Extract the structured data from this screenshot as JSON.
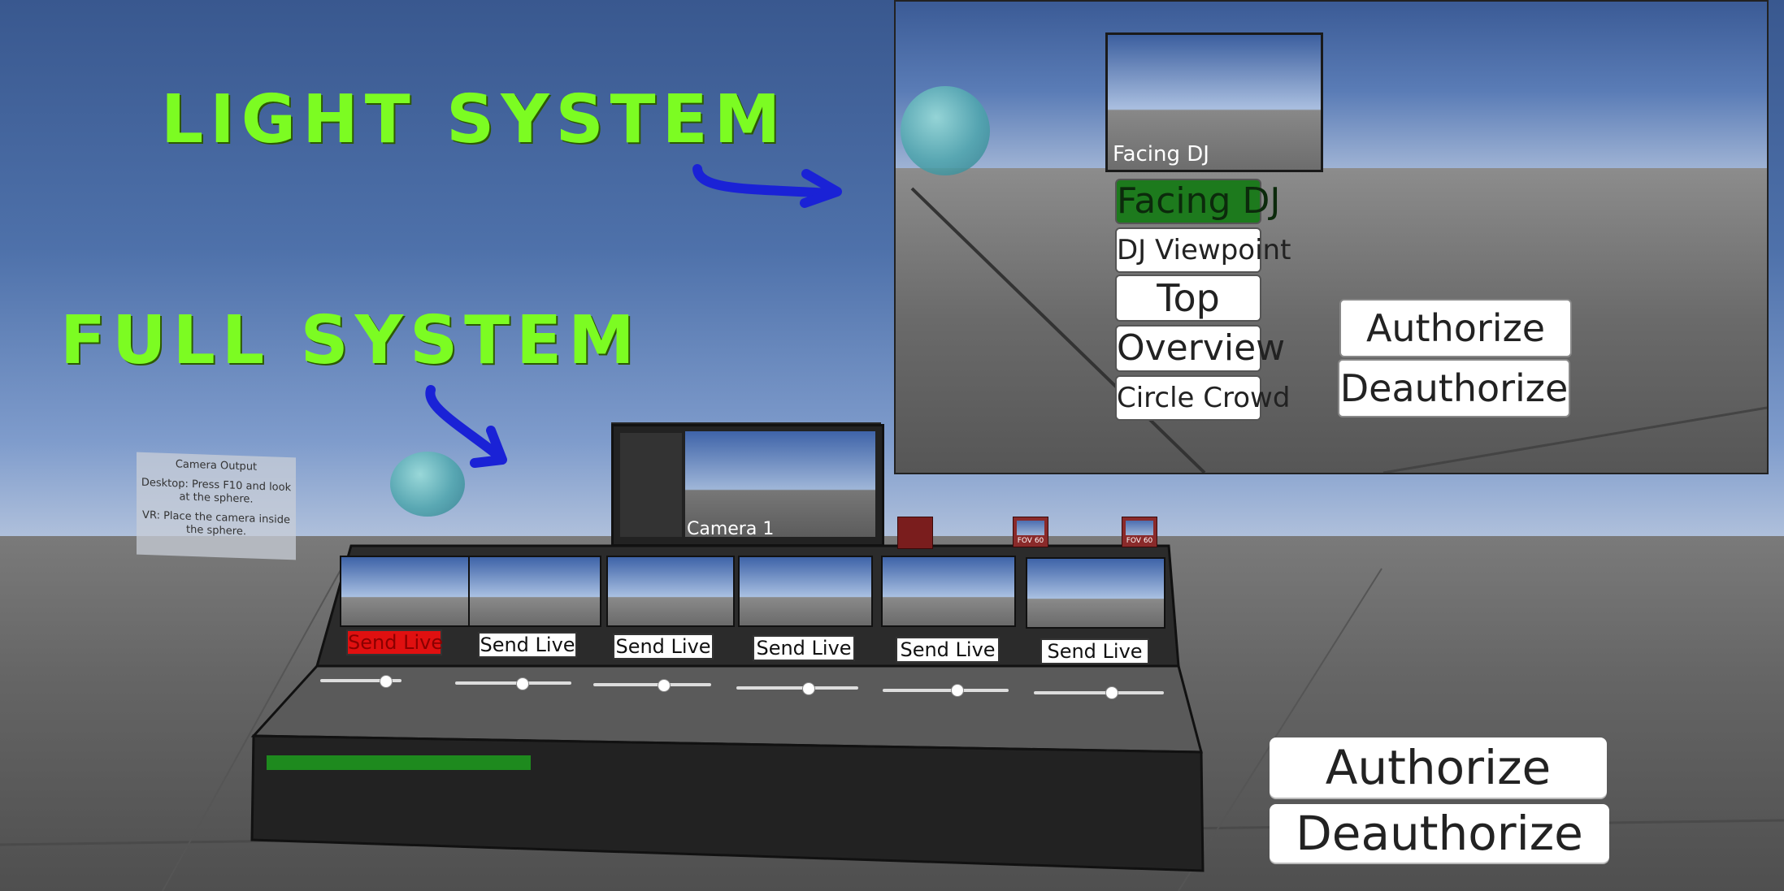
{
  "annotations": {
    "light_system": "LIGHT SYSTEM",
    "full_system": "FULL SYSTEM"
  },
  "camera_note": {
    "title": "Camera Output",
    "desktop": "Desktop: Press F10 and look at the sphere.",
    "vr": "VR: Place the camera inside the sphere."
  },
  "main_monitor": {
    "label": "Camera 1"
  },
  "send_buttons": [
    {
      "label": "Send Live",
      "live": true
    },
    {
      "label": "Send Live",
      "live": false
    },
    {
      "label": "Send Live",
      "live": false
    },
    {
      "label": "Send Live",
      "live": false
    },
    {
      "label": "Send Live",
      "live": false
    },
    {
      "label": "Send Live",
      "live": false
    }
  ],
  "fov_cameras": [
    {
      "label": "FOV 60"
    },
    {
      "label": "FOV 60"
    }
  ],
  "main_auth": {
    "authorize": "Authorize",
    "deauthorize": "Deauthorize"
  },
  "inset": {
    "preview_label": "Facing DJ",
    "camera_buttons": [
      {
        "label": "Facing DJ",
        "active": true
      },
      {
        "label": "DJ Viewpoint",
        "active": false
      },
      {
        "label": "Top",
        "active": false
      },
      {
        "label": "Overview",
        "active": false
      },
      {
        "label": "Circle Crowd",
        "active": false
      }
    ],
    "authorize": "Authorize",
    "deauthorize": "Deauthorize"
  },
  "colors": {
    "annotation_green": "#7cfc22",
    "arrow_blue": "#1a22d6",
    "live_red": "#e01010",
    "active_green": "#1d7a1d"
  }
}
